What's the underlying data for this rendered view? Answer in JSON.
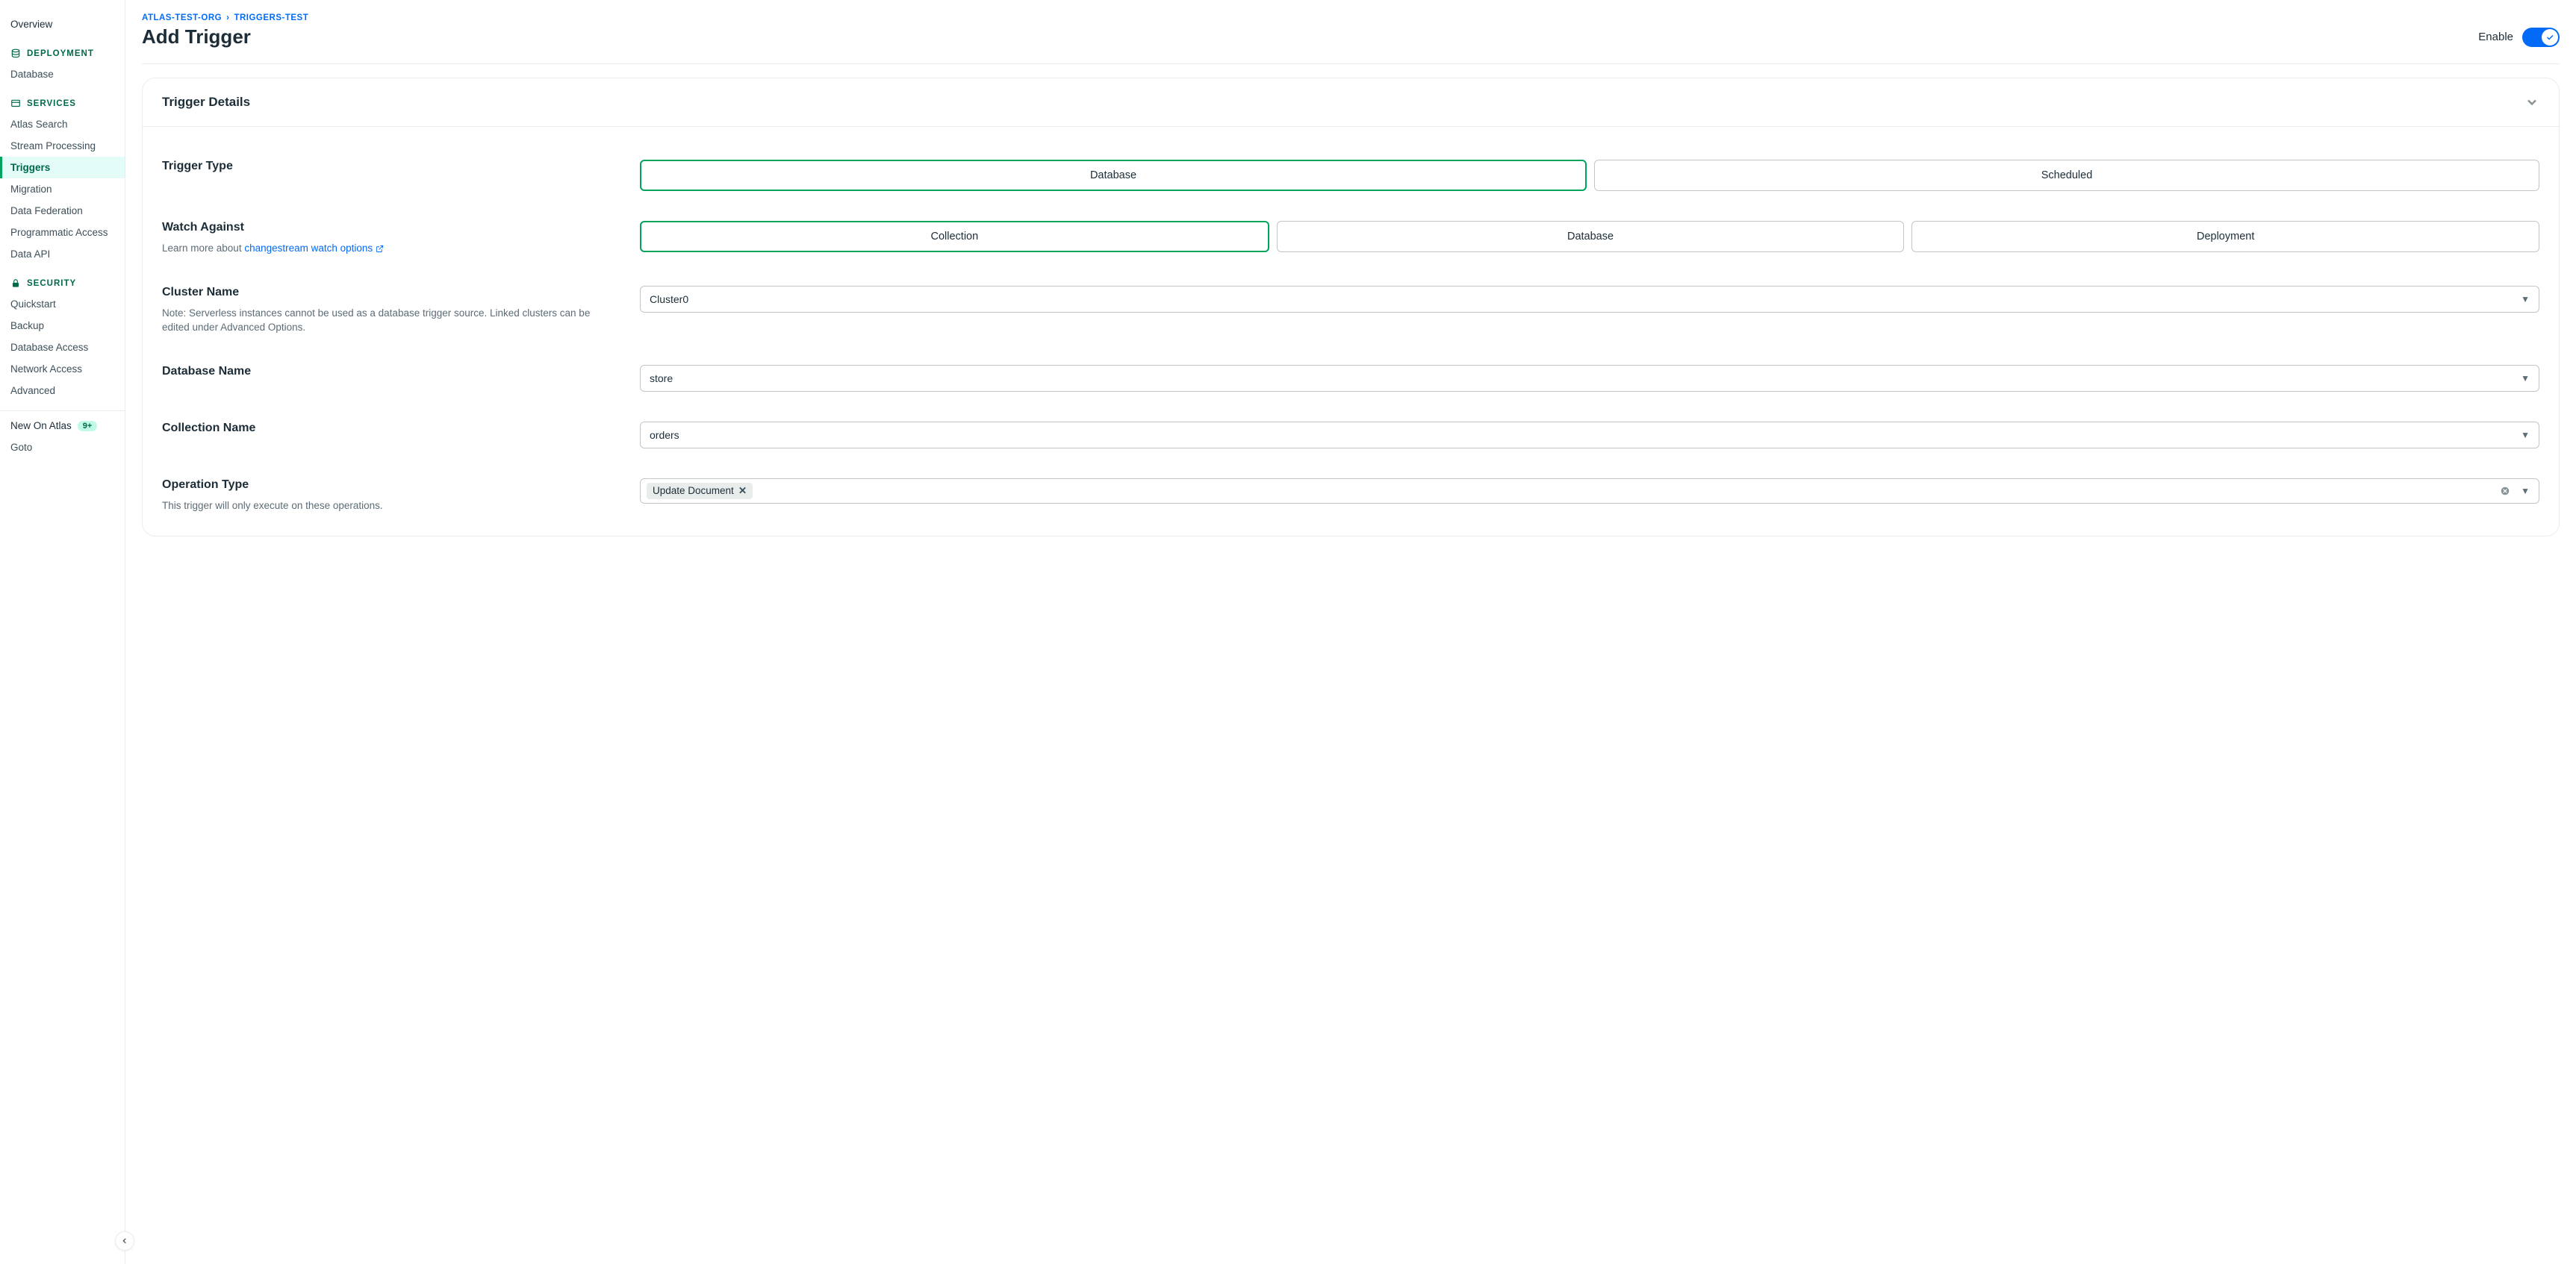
{
  "sidebar": {
    "overview": "Overview",
    "deployment_title": "DEPLOYMENT",
    "deployment_items": [
      "Database"
    ],
    "services_title": "SERVICES",
    "services_items": [
      "Atlas Search",
      "Stream Processing",
      "Triggers",
      "Migration",
      "Data Federation",
      "Programmatic Access",
      "Data API"
    ],
    "services_active_index": 2,
    "security_title": "SECURITY",
    "security_items": [
      "Quickstart",
      "Backup",
      "Database Access",
      "Network Access",
      "Advanced"
    ],
    "new_on_atlas": "New On Atlas",
    "new_badge": "9+",
    "goto": "Goto"
  },
  "breadcrumbs": {
    "org": "ATLAS-TEST-ORG",
    "project": "TRIGGERS-TEST"
  },
  "page": {
    "title": "Add Trigger",
    "enable_label": "Enable"
  },
  "card": {
    "title": "Trigger Details"
  },
  "form": {
    "trigger_type": {
      "label": "Trigger Type",
      "options": [
        "Database",
        "Scheduled"
      ],
      "selected": 0
    },
    "watch_against": {
      "label": "Watch Against",
      "help_prefix": "Learn more about ",
      "help_link": "changestream watch options",
      "options": [
        "Collection",
        "Database",
        "Deployment"
      ],
      "selected": 0
    },
    "cluster_name": {
      "label": "Cluster Name",
      "help": "Note: Serverless instances cannot be used as a database trigger source. Linked clusters can be edited under Advanced Options.",
      "value": "Cluster0"
    },
    "database_name": {
      "label": "Database Name",
      "value": "store"
    },
    "collection_name": {
      "label": "Collection Name",
      "value": "orders"
    },
    "operation_type": {
      "label": "Operation Type",
      "help": "This trigger will only execute on these operations.",
      "chips": [
        "Update Document"
      ]
    }
  }
}
